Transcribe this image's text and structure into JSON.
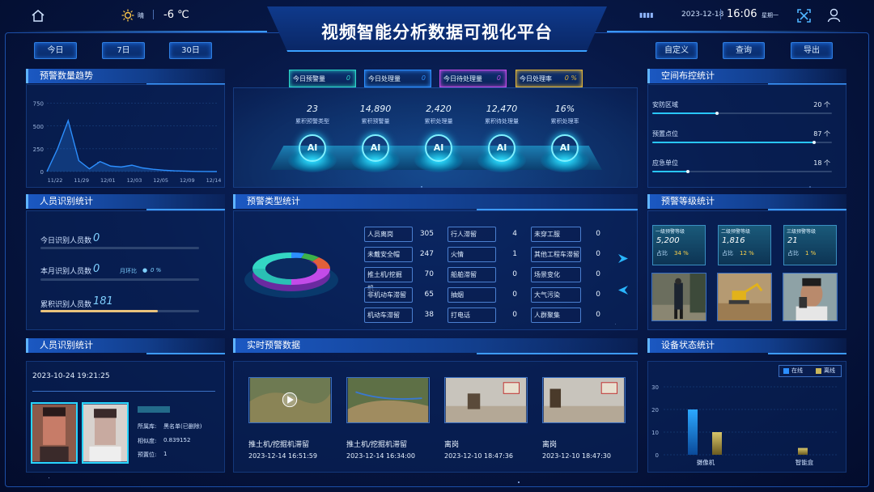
{
  "header": {
    "title": "视频智能分析数据可视化平台",
    "weather": "晴",
    "temp": "-6 ℃",
    "date": "2023-12-18",
    "time": "16:06",
    "weekday": "星期一"
  },
  "toolbar": {
    "left": [
      "今日",
      "7日",
      "30日"
    ],
    "right": [
      "自定义",
      "查询",
      "导出"
    ]
  },
  "trend": {
    "title": "预警数量趋势"
  },
  "chart_data": {
    "type": "line",
    "categories": [
      "11/22",
      "11/29",
      "12/01",
      "12/03",
      "12/05",
      "12/09",
      "12/14"
    ],
    "points": [
      [
        0,
        0
      ],
      [
        1,
        250
      ],
      [
        2,
        560
      ],
      [
        3,
        120
      ],
      [
        4,
        30
      ],
      [
        5,
        110
      ],
      [
        6,
        60
      ],
      [
        7,
        50
      ],
      [
        8,
        70
      ],
      [
        9,
        40
      ],
      [
        10,
        25
      ],
      [
        11,
        15
      ],
      [
        12,
        8
      ],
      [
        13,
        5
      ],
      [
        14,
        2
      ],
      [
        15,
        1
      ],
      [
        16,
        0
      ]
    ],
    "yticks": [
      0,
      250,
      500,
      750
    ],
    "ylim": [
      0,
      800
    ],
    "color": "#2c8fff"
  },
  "kpis": [
    {
      "label": "今日预警量",
      "value": "0",
      "color": "#2bd6c8"
    },
    {
      "label": "今日处理量",
      "value": "0",
      "color": "#2c8fff"
    },
    {
      "label": "今日待处理量",
      "value": "0",
      "color": "#c24be8"
    },
    {
      "label": "今日处理率",
      "value": "0 %",
      "color": "#e0b43a"
    }
  ],
  "stats": [
    {
      "value": "23",
      "label": "累积预警类型"
    },
    {
      "value": "14,890",
      "label": "累积预警量"
    },
    {
      "value": "2,420",
      "label": "累积处理量"
    },
    {
      "value": "12,470",
      "label": "累积待处理量"
    },
    {
      "value": "16%",
      "label": "累积处理率"
    }
  ],
  "ai_label": "AI",
  "space": {
    "title": "空间布控统计",
    "rows": [
      {
        "label": "安防区域",
        "value": "20 个",
        "pct": 0.36
      },
      {
        "label": "预置点位",
        "value": "87 个",
        "pct": 0.9
      },
      {
        "label": "应急单位",
        "value": "18 个",
        "pct": 0.2
      }
    ]
  },
  "person": {
    "title": "人员识别统计",
    "today_label": "今日识别人员数",
    "today_value": "0",
    "month_label": "本月识别人员数",
    "month_value": "0",
    "mom_label": "月环比",
    "mom_value": "0 %",
    "total_label": "累积识别人员数",
    "total_value": "181"
  },
  "types": {
    "title": "预警类型统计",
    "items": [
      {
        "name": "人员离岗",
        "value": "305"
      },
      {
        "name": "行人滞留",
        "value": "4"
      },
      {
        "name": "未穿工服",
        "value": "0"
      },
      {
        "name": "未戴安全帽",
        "value": "247"
      },
      {
        "name": "火情",
        "value": "1"
      },
      {
        "name": "其他工程车滞留",
        "value": "0"
      },
      {
        "name": "推土机/挖掘机...",
        "value": "70"
      },
      {
        "name": "船舶滞留",
        "value": "0"
      },
      {
        "name": "场景变化",
        "value": "0"
      },
      {
        "name": "非机动车滞留",
        "value": "65"
      },
      {
        "name": "抽烟",
        "value": "0"
      },
      {
        "name": "大气污染",
        "value": "0"
      },
      {
        "name": "机动车滞留",
        "value": "38"
      },
      {
        "name": "打电话",
        "value": "0"
      },
      {
        "name": "人群聚集",
        "value": "0"
      }
    ]
  },
  "levels": {
    "title": "预警等级统计",
    "items": [
      {
        "name": "一级预警等级",
        "value": "5,200",
        "ratio_label": "占比",
        "ratio": "34 %"
      },
      {
        "name": "二级预警等级",
        "value": "1,816",
        "ratio_label": "占比",
        "ratio": "12 %"
      },
      {
        "name": "三级预警等级",
        "value": "21",
        "ratio_label": "占比",
        "ratio": "1 %"
      }
    ]
  },
  "recog": {
    "title": "人员识别统计",
    "time": "2023-10-24 19:21:25",
    "db_label": "所属库:",
    "db": "黑名单(已删除)",
    "sim_label": "相似度:",
    "sim": "0.839152",
    "preset_label": "预置位:",
    "preset": "1"
  },
  "realtime": {
    "title": "实时预警数据",
    "items": [
      {
        "name": "推土机/挖掘机滞留",
        "time": "2023-12-14 16:51:59"
      },
      {
        "name": "推土机/挖掘机滞留",
        "time": "2023-12-14 16:34:00"
      },
      {
        "name": "离岗",
        "time": "2023-12-10 18:47:36"
      },
      {
        "name": "离岗",
        "time": "2023-12-10 18:47:30"
      }
    ]
  },
  "device": {
    "title": "设备状态统计",
    "legend": [
      "在线",
      "离线"
    ],
    "categories": [
      "摄像机",
      "智能盒"
    ],
    "online": [
      20,
      0
    ],
    "offline": [
      10,
      3
    ],
    "yticks": [
      0,
      10,
      20,
      30
    ],
    "ylim": [
      0,
      30
    ]
  }
}
